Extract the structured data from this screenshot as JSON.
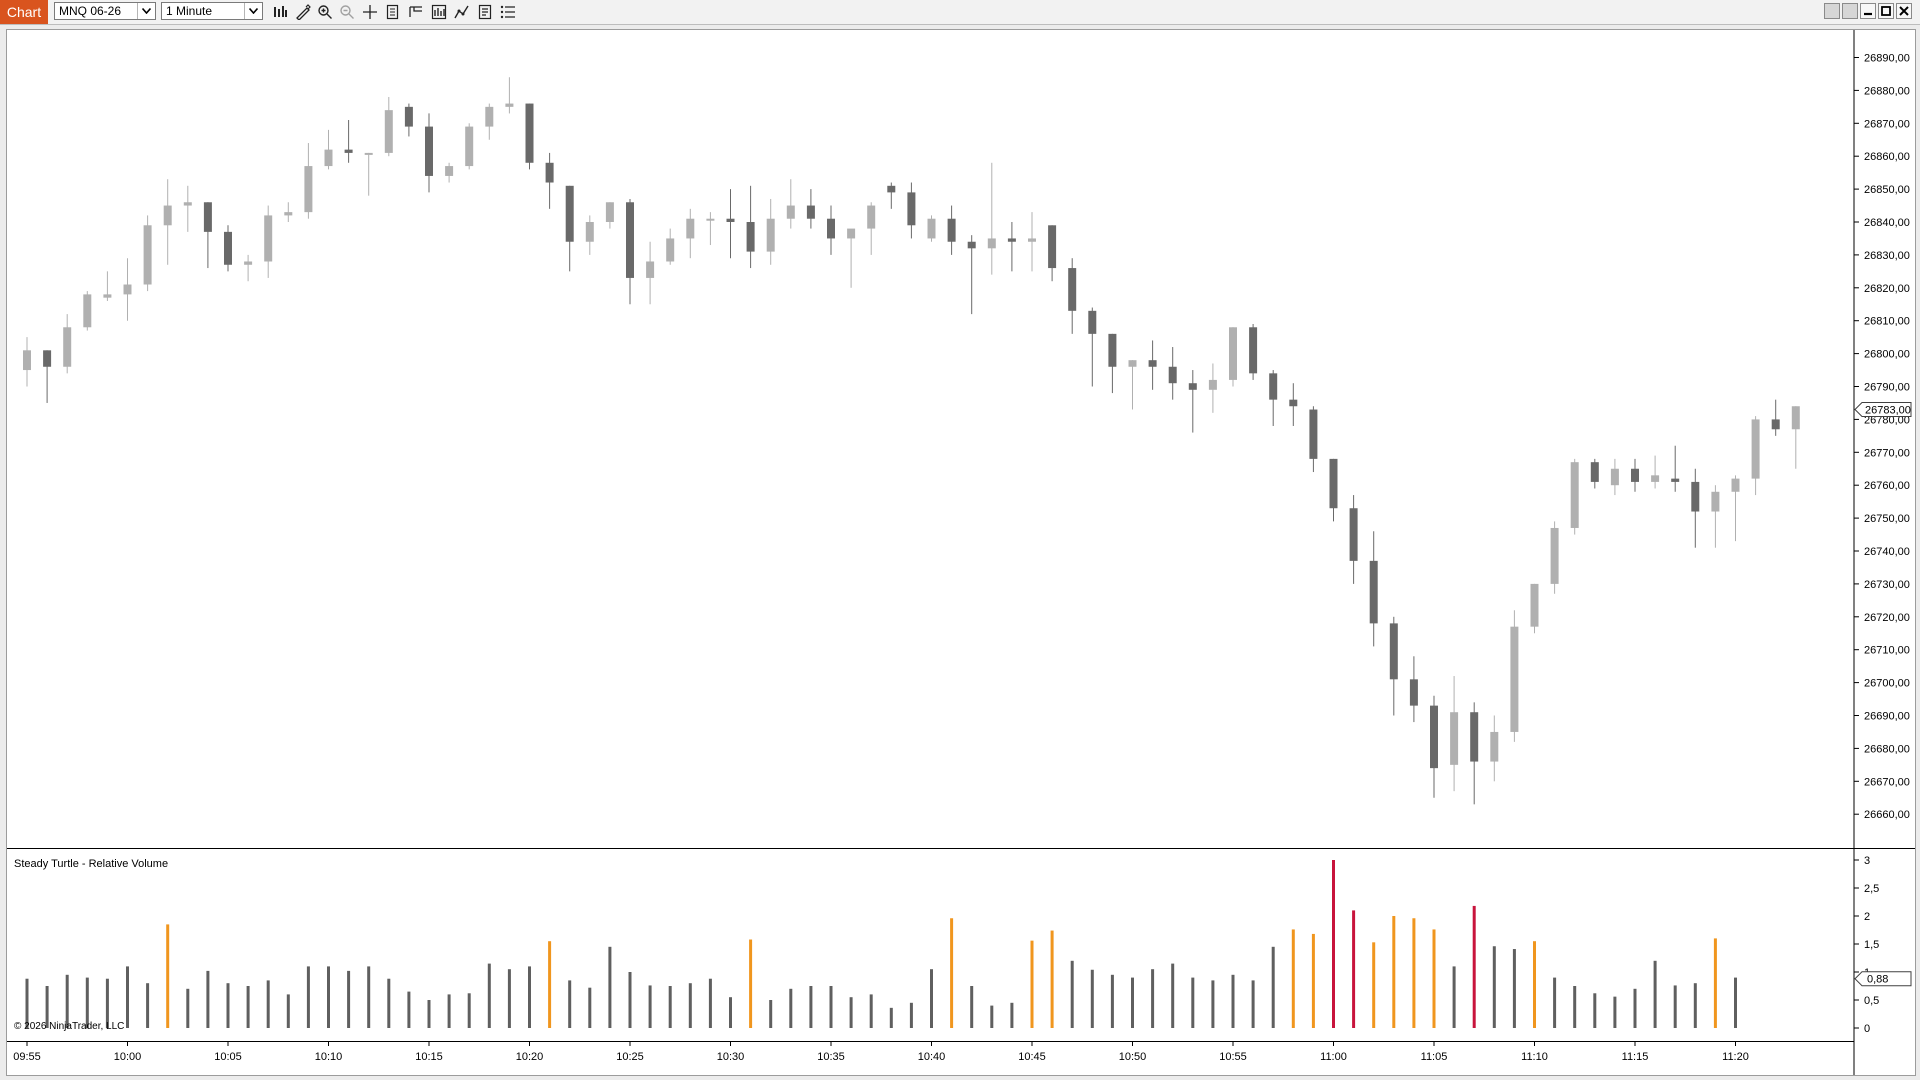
{
  "toolbar": {
    "tab_label": "Chart",
    "instrument": "MNQ 06-26",
    "interval": "1 Minute",
    "icons": [
      "bar-type-icon",
      "drawing-tool-icon",
      "zoom-in-icon",
      "zoom-out-icon",
      "crosshair-icon",
      "data-box-icon",
      "chart-trader-icon",
      "indicators-icon",
      "strategies-icon",
      "properties-icon"
    ]
  },
  "indicator_panel": {
    "label": "Steady Turtle - Relative Volume"
  },
  "copyright": "© 2026 NinjaTrader, LLC",
  "colors": {
    "up_candle": "#b0b0b0",
    "down_candle": "#696969",
    "volume_normal": "#5f5f5f",
    "volume_elevated": "#f0961e",
    "volume_extreme": "#c8143c",
    "accent": "#d9541e"
  },
  "chart_data": {
    "type": "candlestick",
    "price_axis": {
      "ticks": [
        "26890,00",
        "26880,00",
        "26870,00",
        "26860,00",
        "26850,00",
        "26840,00",
        "26830,00",
        "26820,00",
        "26810,00",
        "26800,00",
        "26790,00",
        "26780,00",
        "26770,00",
        "26760,00",
        "26750,00",
        "26740,00",
        "26730,00",
        "26720,00",
        "26710,00",
        "26700,00",
        "26690,00",
        "26680,00",
        "26670,00",
        "26660,00"
      ],
      "last_price_label": "26783,00",
      "last_price": 26783
    },
    "time_axis": {
      "ticks": [
        "09:55",
        "10:00",
        "10:05",
        "10:10",
        "10:15",
        "10:20",
        "10:25",
        "10:30",
        "10:35",
        "10:40",
        "10:45",
        "10:50",
        "10:55",
        "11:00",
        "11:05",
        "11:10",
        "11:15",
        "11:20"
      ]
    },
    "bar_start": "09:55",
    "bars": [
      {
        "o": 26795,
        "h": 26805,
        "l": 26790,
        "c": 26801
      },
      {
        "o": 26801,
        "h": 26801,
        "l": 26785,
        "c": 26796
      },
      {
        "o": 26796,
        "h": 26812,
        "l": 26794,
        "c": 26808
      },
      {
        "o": 26808,
        "h": 26819,
        "l": 26807,
        "c": 26818
      },
      {
        "o": 26817,
        "h": 26825,
        "l": 26816,
        "c": 26818
      },
      {
        "o": 26818,
        "h": 26829,
        "l": 26810,
        "c": 26821
      },
      {
        "o": 26821,
        "h": 26842,
        "l": 26819,
        "c": 26839
      },
      {
        "o": 26839,
        "h": 26853,
        "l": 26827,
        "c": 26845
      },
      {
        "o": 26845,
        "h": 26851,
        "l": 26837,
        "c": 26846
      },
      {
        "o": 26846,
        "h": 26846,
        "l": 26826,
        "c": 26837
      },
      {
        "o": 26837,
        "h": 26839,
        "l": 26825,
        "c": 26827
      },
      {
        "o": 26827,
        "h": 26830,
        "l": 26822,
        "c": 26828
      },
      {
        "o": 26828,
        "h": 26845,
        "l": 26823,
        "c": 26842
      },
      {
        "o": 26842,
        "h": 26846,
        "l": 26840,
        "c": 26843
      },
      {
        "o": 26843,
        "h": 26864,
        "l": 26841,
        "c": 26857
      },
      {
        "o": 26857,
        "h": 26868,
        "l": 26856,
        "c": 26862
      },
      {
        "o": 26862,
        "h": 26871,
        "l": 26858,
        "c": 26861
      },
      {
        "o": 26861,
        "h": 26861,
        "l": 26848,
        "c": 26861
      },
      {
        "o": 26861,
        "h": 26878,
        "l": 26860,
        "c": 26874
      },
      {
        "o": 26875,
        "h": 26876,
        "l": 26866,
        "c": 26869
      },
      {
        "o": 26869,
        "h": 26873,
        "l": 26849,
        "c": 26854
      },
      {
        "o": 26854,
        "h": 26858,
        "l": 26852,
        "c": 26857
      },
      {
        "o": 26857,
        "h": 26870,
        "l": 26856,
        "c": 26869
      },
      {
        "o": 26869,
        "h": 26876,
        "l": 26865,
        "c": 26875
      },
      {
        "o": 26875,
        "h": 26884,
        "l": 26873,
        "c": 26876
      },
      {
        "o": 26876,
        "h": 26876,
        "l": 26856,
        "c": 26858
      },
      {
        "o": 26858,
        "h": 26861,
        "l": 26844,
        "c": 26852
      },
      {
        "o": 26851,
        "h": 26851,
        "l": 26825,
        "c": 26834
      },
      {
        "o": 26834,
        "h": 26842,
        "l": 26830,
        "c": 26840
      },
      {
        "o": 26840,
        "h": 26846,
        "l": 26838,
        "c": 26846
      },
      {
        "o": 26846,
        "h": 26847,
        "l": 26815,
        "c": 26823
      },
      {
        "o": 26823,
        "h": 26834,
        "l": 26815,
        "c": 26828
      },
      {
        "o": 26828,
        "h": 26838,
        "l": 26827,
        "c": 26835
      },
      {
        "o": 26835,
        "h": 26844,
        "l": 26829,
        "c": 26841
      },
      {
        "o": 26841,
        "h": 26843,
        "l": 26833,
        "c": 26841
      },
      {
        "o": 26841,
        "h": 26850,
        "l": 26829,
        "c": 26840
      },
      {
        "o": 26840,
        "h": 26851,
        "l": 26826,
        "c": 26831
      },
      {
        "o": 26831,
        "h": 26847,
        "l": 26827,
        "c": 26841
      },
      {
        "o": 26841,
        "h": 26853,
        "l": 26838,
        "c": 26845
      },
      {
        "o": 26845,
        "h": 26850,
        "l": 26838,
        "c": 26841
      },
      {
        "o": 26841,
        "h": 26845,
        "l": 26830,
        "c": 26835
      },
      {
        "o": 26835,
        "h": 26836,
        "l": 26820,
        "c": 26838
      },
      {
        "o": 26838,
        "h": 26846,
        "l": 26830,
        "c": 26845
      },
      {
        "o": 26851,
        "h": 26852,
        "l": 26844,
        "c": 26849
      },
      {
        "o": 26849,
        "h": 26852,
        "l": 26835,
        "c": 26839
      },
      {
        "o": 26835,
        "h": 26842,
        "l": 26834,
        "c": 26841
      },
      {
        "o": 26841,
        "h": 26845,
        "l": 26830,
        "c": 26834
      },
      {
        "o": 26834,
        "h": 26836,
        "l": 26812,
        "c": 26832
      },
      {
        "o": 26832,
        "h": 26858,
        "l": 26824,
        "c": 26835
      },
      {
        "o": 26835,
        "h": 26840,
        "l": 26825,
        "c": 26834
      },
      {
        "o": 26834,
        "h": 26843,
        "l": 26825,
        "c": 26835
      },
      {
        "o": 26839,
        "h": 26839,
        "l": 26822,
        "c": 26826
      },
      {
        "o": 26826,
        "h": 26829,
        "l": 26806,
        "c": 26813
      },
      {
        "o": 26813,
        "h": 26814,
        "l": 26790,
        "c": 26806
      },
      {
        "o": 26806,
        "h": 26806,
        "l": 26788,
        "c": 26796
      },
      {
        "o": 26796,
        "h": 26798,
        "l": 26783,
        "c": 26798
      },
      {
        "o": 26798,
        "h": 26804,
        "l": 26789,
        "c": 26796
      },
      {
        "o": 26796,
        "h": 26802,
        "l": 26786,
        "c": 26791
      },
      {
        "o": 26791,
        "h": 26795,
        "l": 26776,
        "c": 26789
      },
      {
        "o": 26789,
        "h": 26797,
        "l": 26782,
        "c": 26792
      },
      {
        "o": 26792,
        "h": 26808,
        "l": 26790,
        "c": 26808
      },
      {
        "o": 26808,
        "h": 26809,
        "l": 26792,
        "c": 26794
      },
      {
        "o": 26794,
        "h": 26795,
        "l": 26778,
        "c": 26786
      },
      {
        "o": 26786,
        "h": 26791,
        "l": 26778,
        "c": 26784
      },
      {
        "o": 26783,
        "h": 26784,
        "l": 26764,
        "c": 26768
      },
      {
        "o": 26768,
        "h": 26768,
        "l": 26749,
        "c": 26753
      },
      {
        "o": 26753,
        "h": 26757,
        "l": 26730,
        "c": 26737
      },
      {
        "o": 26737,
        "h": 26746,
        "l": 26711,
        "c": 26718
      },
      {
        "o": 26718,
        "h": 26720,
        "l": 26690,
        "c": 26701
      },
      {
        "o": 26701,
        "h": 26708,
        "l": 26688,
        "c": 26693
      },
      {
        "o": 26693,
        "h": 26696,
        "l": 26665,
        "c": 26674
      },
      {
        "o": 26675,
        "h": 26702,
        "l": 26667,
        "c": 26691
      },
      {
        "o": 26691,
        "h": 26694,
        "l": 26663,
        "c": 26676
      },
      {
        "o": 26676,
        "h": 26690,
        "l": 26670,
        "c": 26685
      },
      {
        "o": 26685,
        "h": 26722,
        "l": 26682,
        "c": 26717
      },
      {
        "o": 26717,
        "h": 26730,
        "l": 26715,
        "c": 26730
      },
      {
        "o": 26730,
        "h": 26749,
        "l": 26727,
        "c": 26747
      },
      {
        "o": 26747,
        "h": 26768,
        "l": 26745,
        "c": 26767
      },
      {
        "o": 26767,
        "h": 26768,
        "l": 26759,
        "c": 26761
      },
      {
        "o": 26760,
        "h": 26768,
        "l": 26757,
        "c": 26765
      },
      {
        "o": 26765,
        "h": 26768,
        "l": 26758,
        "c": 26761
      },
      {
        "o": 26761,
        "h": 26769,
        "l": 26759,
        "c": 26763
      },
      {
        "o": 26762,
        "h": 26772,
        "l": 26758,
        "c": 26761
      },
      {
        "o": 26761,
        "h": 26765,
        "l": 26741,
        "c": 26752
      },
      {
        "o": 26752,
        "h": 26760,
        "l": 26741,
        "c": 26758
      },
      {
        "o": 26758,
        "h": 26763,
        "l": 26743,
        "c": 26762
      },
      {
        "o": 26762,
        "h": 26781,
        "l": 26757,
        "c": 26780
      },
      {
        "o": 26780,
        "h": 26786,
        "l": 26775,
        "c": 26777
      },
      {
        "o": 26777,
        "h": 26784,
        "l": 26765,
        "c": 26784
      }
    ],
    "volume_axis": {
      "ticks": [
        "3",
        "2,5",
        "2",
        "1,5",
        "1",
        "0,5",
        "0"
      ],
      "last_value_label": "0,88",
      "last_value": 0.88
    },
    "relative_volume": [
      0.88,
      0.75,
      0.95,
      0.9,
      0.88,
      1.1,
      0.8,
      1.85,
      0.7,
      1.02,
      0.8,
      0.75,
      0.85,
      0.6,
      1.1,
      1.1,
      1.02,
      1.1,
      0.88,
      0.65,
      0.5,
      0.6,
      0.62,
      1.15,
      1.05,
      1.1,
      1.55,
      0.85,
      0.72,
      1.45,
      1,
      0.76,
      0.75,
      0.8,
      0.88,
      0.55,
      1.58,
      0.5,
      0.7,
      0.75,
      0.75,
      0.55,
      0.6,
      0.36,
      0.45,
      1.05,
      1.96,
      0.75,
      0.4,
      0.45,
      1.56,
      1.74,
      1.2,
      1.04,
      0.95,
      0.9,
      1.05,
      1.15,
      0.9,
      0.85,
      0.95,
      0.85,
      1.45,
      1.76,
      1.68,
      3,
      2.1,
      1.53,
      2,
      1.96,
      1.76,
      1.1,
      2.18,
      1.46,
      1.41,
      1.55,
      0.9,
      0.75,
      0.62,
      0.56,
      0.7,
      1.2,
      0.76,
      0.8,
      1.6,
      0.9
    ],
    "volume_colors": [
      "volume_normal",
      "volume_normal",
      "volume_normal",
      "volume_normal",
      "volume_normal",
      "volume_normal",
      "volume_normal",
      "volume_elevated",
      "volume_normal",
      "volume_normal",
      "volume_normal",
      "volume_normal",
      "volume_normal",
      "volume_normal",
      "volume_normal",
      "volume_normal",
      "volume_normal",
      "volume_normal",
      "volume_normal",
      "volume_normal",
      "volume_normal",
      "volume_normal",
      "volume_normal",
      "volume_normal",
      "volume_normal",
      "volume_normal",
      "volume_elevated",
      "volume_normal",
      "volume_normal",
      "volume_normal",
      "volume_normal",
      "volume_normal",
      "volume_normal",
      "volume_normal",
      "volume_normal",
      "volume_normal",
      "volume_elevated",
      "volume_normal",
      "volume_normal",
      "volume_normal",
      "volume_normal",
      "volume_normal",
      "volume_normal",
      "volume_normal",
      "volume_normal",
      "volume_normal",
      "volume_elevated",
      "volume_normal",
      "volume_normal",
      "volume_normal",
      "volume_elevated",
      "volume_elevated",
      "volume_normal",
      "volume_normal",
      "volume_normal",
      "volume_normal",
      "volume_normal",
      "volume_normal",
      "volume_normal",
      "volume_normal",
      "volume_normal",
      "volume_normal",
      "volume_normal",
      "volume_elevated",
      "volume_elevated",
      "volume_extreme",
      "volume_extreme",
      "volume_elevated",
      "volume_elevated",
      "volume_elevated",
      "volume_elevated",
      "volume_normal",
      "volume_extreme",
      "volume_normal",
      "volume_normal",
      "volume_elevated",
      "volume_normal",
      "volume_normal",
      "volume_normal",
      "volume_normal",
      "volume_normal",
      "volume_normal",
      "volume_normal",
      "volume_normal",
      "volume_elevated",
      "volume_normal"
    ]
  }
}
